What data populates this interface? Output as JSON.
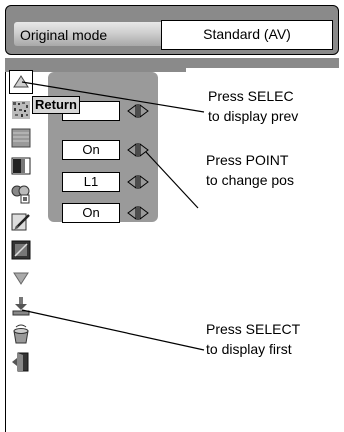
{
  "header": {
    "mode_label": "Original mode",
    "mode_value": "Standard (AV)"
  },
  "tooltip": {
    "return_label": "Return"
  },
  "rows": [
    {
      "value": ""
    },
    {
      "value": "On"
    },
    {
      "value": "L1"
    },
    {
      "value": "On"
    }
  ],
  "callouts": [
    {
      "line1": "Press SELEC",
      "line2": "to display prev"
    },
    {
      "line1": "Press POINT",
      "line2": "to change pos"
    },
    {
      "line1": "Press SELECT",
      "line2": "to display first"
    }
  ],
  "icons": [
    "up-arrow-icon",
    "noise-pattern-icon",
    "gray-bars-icon",
    "contrast-icon",
    "color-balloons-icon",
    "brush-icon",
    "dark-pattern-icon",
    "down-arrow-icon",
    "download-icon",
    "bucket-icon",
    "exit-door-icon"
  ]
}
